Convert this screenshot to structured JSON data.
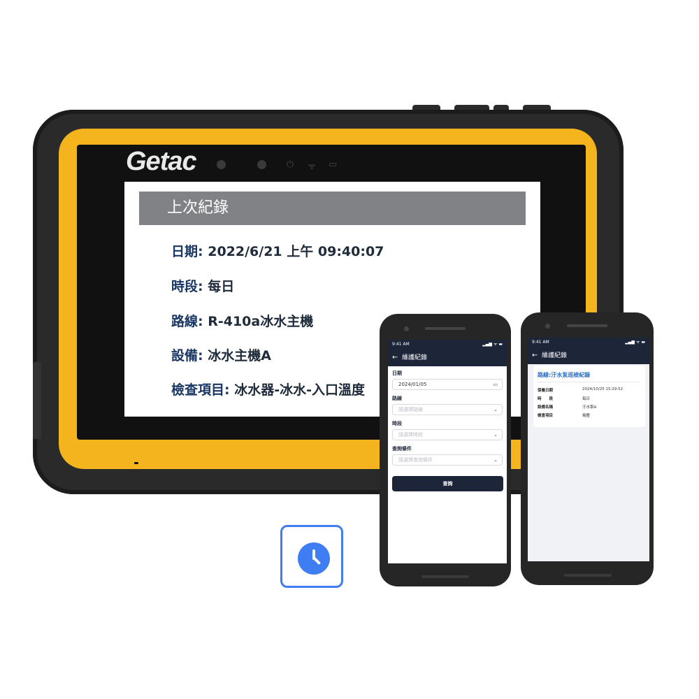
{
  "tablet": {
    "brand": "Getac",
    "screen": {
      "header": "上次紀錄",
      "records": [
        {
          "label": "日期:",
          "value": " 2022/6/21 上午 09:40:07"
        },
        {
          "label": "時段:",
          "value": " 每日"
        },
        {
          "label": "路線:",
          "value": " R-410a冰水主機"
        },
        {
          "label": "設備:",
          "value": " 冰水主機A"
        },
        {
          "label": "檢查項目:",
          "value": " 冰水器-冰水-入口溫度"
        }
      ]
    }
  },
  "icons": {
    "clock": "clock-icon",
    "back": "arrow-left-icon",
    "calendar": "calendar-icon",
    "chevron": "chevron-down-icon",
    "signal": "signal-icon",
    "wifi": "wifi-icon",
    "battery": "battery-icon"
  },
  "phone1": {
    "time": "9:41 AM",
    "status_icons": "▂▄▆ ᯤ ▬",
    "back_glyph": "←",
    "title": "維護紀錄",
    "fields": [
      {
        "label": "日期",
        "value": "2024/01/05",
        "end": "▭"
      },
      {
        "label": "路線",
        "placeholder": "請選擇路線",
        "end": "⌄"
      },
      {
        "label": "時段",
        "placeholder": "請選擇時段",
        "end": "⌄"
      },
      {
        "label": "查詢條件",
        "placeholder": "請選擇查詢條件",
        "end": "⌄"
      }
    ],
    "button": "查詢"
  },
  "phone2": {
    "time": "9:41 AM",
    "status_icons": "▂▄▆ ᯤ ▬",
    "back_glyph": "←",
    "title": "維護紀錄",
    "card": {
      "title": "路線:汙水泵巡檢紀錄",
      "rows": [
        {
          "k": "保養日期",
          "v": "2024/10/25 15:29:52"
        },
        {
          "k": "時　　段",
          "v": "每日"
        },
        {
          "k": "設備名稱",
          "v": "汙水泵A"
        },
        {
          "k": "檢查項目",
          "v": "電壓"
        }
      ]
    }
  },
  "colors": {
    "tablet_bezel": "#f4b41e",
    "header_gray": "#808285",
    "navy": "#1d2538",
    "accent_blue": "#3f7ef2",
    "link_blue": "#2a6fc9"
  }
}
